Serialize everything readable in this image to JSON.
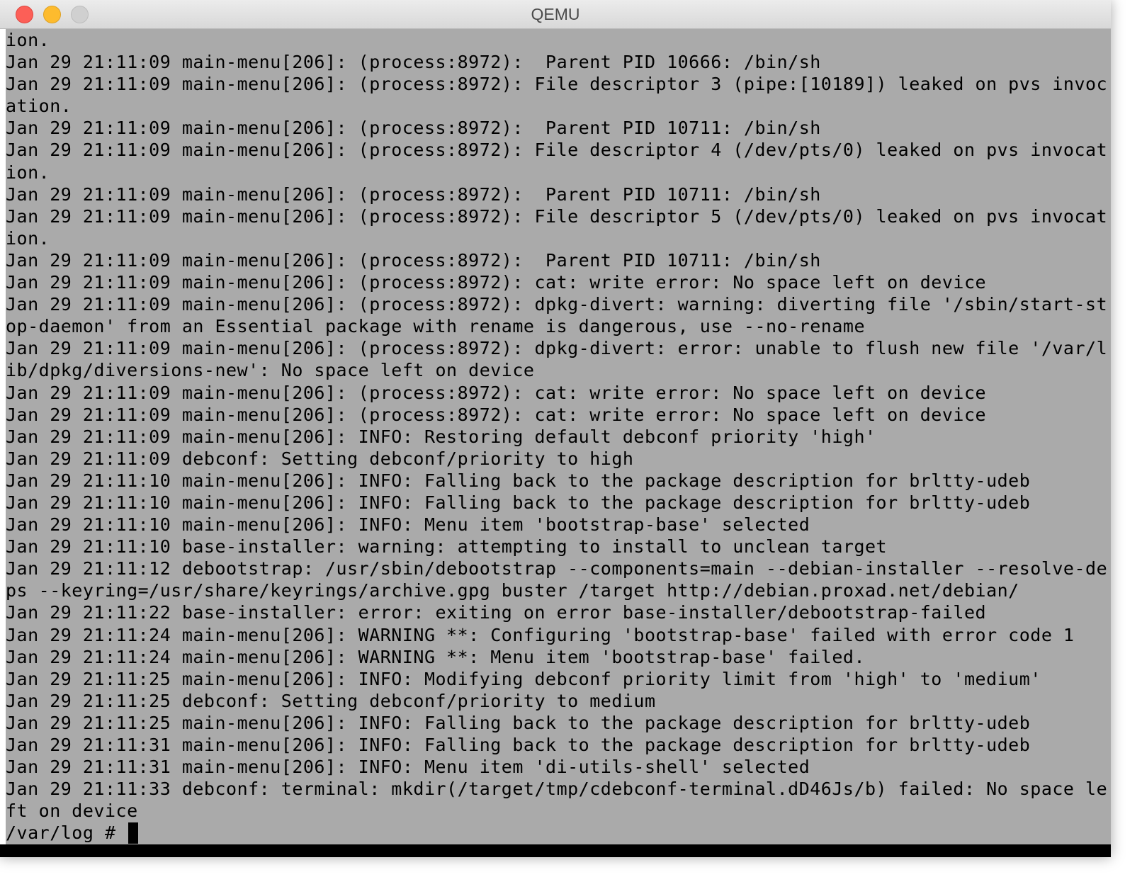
{
  "window": {
    "title": "QEMU"
  },
  "colors": {
    "terminal_background": "#aaaaaa",
    "terminal_text": "#000000",
    "close_button": "#fc5f57",
    "minimize_button": "#fdbb2e",
    "zoom_button": "#d0d0d0"
  },
  "terminal": {
    "lines": [
      "ion.",
      "Jan 29 21:11:09 main-menu[206]: (process:8972):  Parent PID 10666: /bin/sh",
      "Jan 29 21:11:09 main-menu[206]: (process:8972): File descriptor 3 (pipe:[10189]) leaked on pvs invoc",
      "ation.",
      "Jan 29 21:11:09 main-menu[206]: (process:8972):  Parent PID 10711: /bin/sh",
      "Jan 29 21:11:09 main-menu[206]: (process:8972): File descriptor 4 (/dev/pts/0) leaked on pvs invocat",
      "ion.",
      "Jan 29 21:11:09 main-menu[206]: (process:8972):  Parent PID 10711: /bin/sh",
      "Jan 29 21:11:09 main-menu[206]: (process:8972): File descriptor 5 (/dev/pts/0) leaked on pvs invocat",
      "ion.",
      "Jan 29 21:11:09 main-menu[206]: (process:8972):  Parent PID 10711: /bin/sh",
      "Jan 29 21:11:09 main-menu[206]: (process:8972): cat: write error: No space left on device",
      "Jan 29 21:11:09 main-menu[206]: (process:8972): dpkg-divert: warning: diverting file '/sbin/start-st",
      "op-daemon' from an Essential package with rename is dangerous, use --no-rename",
      "Jan 29 21:11:09 main-menu[206]: (process:8972): dpkg-divert: error: unable to flush new file '/var/l",
      "ib/dpkg/diversions-new': No space left on device",
      "Jan 29 21:11:09 main-menu[206]: (process:8972): cat: write error: No space left on device",
      "Jan 29 21:11:09 main-menu[206]: (process:8972): cat: write error: No space left on device",
      "Jan 29 21:11:09 main-menu[206]: INFO: Restoring default debconf priority 'high'",
      "Jan 29 21:11:09 debconf: Setting debconf/priority to high",
      "Jan 29 21:11:10 main-menu[206]: INFO: Falling back to the package description for brltty-udeb",
      "Jan 29 21:11:10 main-menu[206]: INFO: Falling back to the package description for brltty-udeb",
      "Jan 29 21:11:10 main-menu[206]: INFO: Menu item 'bootstrap-base' selected",
      "Jan 29 21:11:10 base-installer: warning: attempting to install to unclean target",
      "Jan 29 21:11:12 debootstrap: /usr/sbin/debootstrap --components=main --debian-installer --resolve-de",
      "ps --keyring=/usr/share/keyrings/archive.gpg buster /target http://debian.proxad.net/debian/",
      "Jan 29 21:11:22 base-installer: error: exiting on error base-installer/debootstrap-failed",
      "Jan 29 21:11:24 main-menu[206]: WARNING **: Configuring 'bootstrap-base' failed with error code 1",
      "Jan 29 21:11:24 main-menu[206]: WARNING **: Menu item 'bootstrap-base' failed.",
      "Jan 29 21:11:25 main-menu[206]: INFO: Modifying debconf priority limit from 'high' to 'medium'",
      "Jan 29 21:11:25 debconf: Setting debconf/priority to medium",
      "Jan 29 21:11:25 main-menu[206]: INFO: Falling back to the package description for brltty-udeb",
      "Jan 29 21:11:31 main-menu[206]: INFO: Falling back to the package description for brltty-udeb",
      "Jan 29 21:11:31 main-menu[206]: INFO: Menu item 'di-utils-shell' selected",
      "Jan 29 21:11:33 debconf: terminal: mkdir(/target/tmp/cdebconf-terminal.dD46Js/b) failed: No space le",
      "ft on device"
    ],
    "prompt": "/var/log # "
  }
}
